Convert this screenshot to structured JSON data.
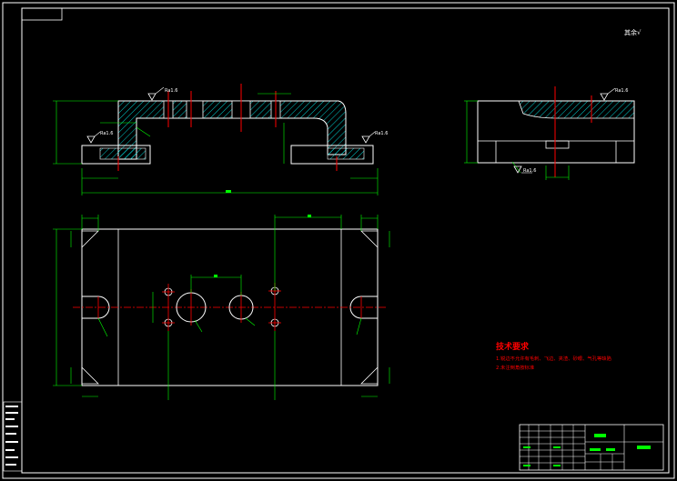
{
  "drawing": {
    "background_color": "#000000",
    "colors": {
      "frame": "#ffffff",
      "outline": "#ffffff",
      "dimension": "#00ff00",
      "center_line": "#ff0000",
      "hatch": "#00ffff",
      "notes": "#ff0000",
      "title_highlight": "#00ff00"
    },
    "roughness_mark_note": "其余√",
    "front_view": {
      "roughness_labels": [
        "Ra1.6",
        "Ra1.6",
        "Ra1.6"
      ]
    },
    "side_view": {
      "roughness_labels": [
        "Ra1.6",
        "Ra1.6"
      ]
    },
    "technical_requirements": {
      "title": "技术要求",
      "items": [
        "1.锐边不允许有毛刺、飞边、夹渣、砂眼、气孔等缺陷",
        "2.未注倒角按标准"
      ]
    }
  }
}
